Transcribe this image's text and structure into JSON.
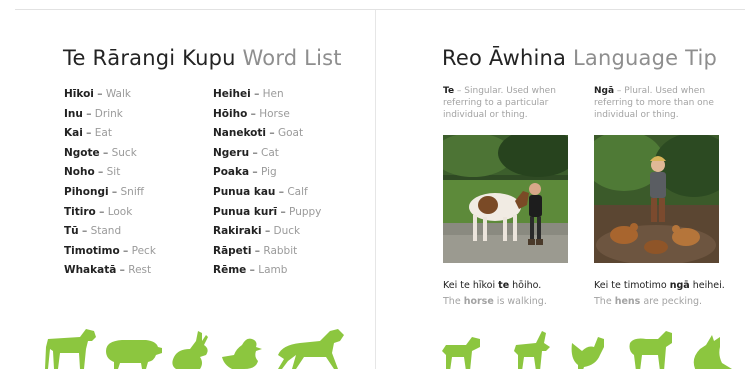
{
  "left": {
    "title_mi": "Te Rārangi Kupu",
    "title_en": "Word List",
    "col1": [
      {
        "mi": "Hīkoi",
        "en": "Walk"
      },
      {
        "mi": "Inu",
        "en": "Drink"
      },
      {
        "mi": "Kai",
        "en": "Eat"
      },
      {
        "mi": "Ngote",
        "en": "Suck"
      },
      {
        "mi": "Noho",
        "en": "Sit"
      },
      {
        "mi": "Pihongi",
        "en": "Sniff"
      },
      {
        "mi": "Titiro",
        "en": "Look"
      },
      {
        "mi": "Tū",
        "en": "Stand"
      },
      {
        "mi": "Timotimo",
        "en": "Peck"
      },
      {
        "mi": "Whakatā",
        "en": "Rest"
      }
    ],
    "col2": [
      {
        "mi": "Heihei",
        "en": "Hen"
      },
      {
        "mi": "Hōiho",
        "en": "Horse"
      },
      {
        "mi": "Nanekoti",
        "en": "Goat"
      },
      {
        "mi": "Ngeru",
        "en": "Cat"
      },
      {
        "mi": "Poaka",
        "en": "Pig"
      },
      {
        "mi": "Punua kau",
        "en": "Calf"
      },
      {
        "mi": "Punua kurī",
        "en": "Puppy"
      },
      {
        "mi": "Rakiraki",
        "en": "Duck"
      },
      {
        "mi": "Rāpeti",
        "en": "Rabbit"
      },
      {
        "mi": "Rēme",
        "en": "Lamb"
      }
    ],
    "separator": "–",
    "silhouettes": [
      "calf-icon",
      "pig-icon",
      "rabbit-icon",
      "duck-icon",
      "horse-icon"
    ]
  },
  "right": {
    "title_mi": "Reo Āwhina",
    "title_en": "Language Tip",
    "tip1": {
      "term": "Te",
      "text": " – Singular. Used when referring to a particular individual or thing."
    },
    "tip2": {
      "term": "Ngā",
      "text": " – Plural. Used when referring to more than one individual or thing."
    },
    "caption1": {
      "mi_a": "Kei te hīkoi ",
      "mi_b": "te",
      "mi_c": " hōiho.",
      "en_a": "The ",
      "en_b": "horse",
      "en_c": " is walking."
    },
    "caption2": {
      "mi_a": "Kei te timotimo ",
      "mi_b": "ngā",
      "mi_c": " heihei.",
      "en_a": "The ",
      "en_b": "hens",
      "en_c": " are pecking."
    },
    "silhouettes": [
      "puppy-icon",
      "goat-icon",
      "hen-icon",
      "lamb-icon",
      "cat-icon"
    ]
  },
  "colors": {
    "accent": "#8cc63f",
    "title": "#232323",
    "muted": "#9a9a9a"
  }
}
